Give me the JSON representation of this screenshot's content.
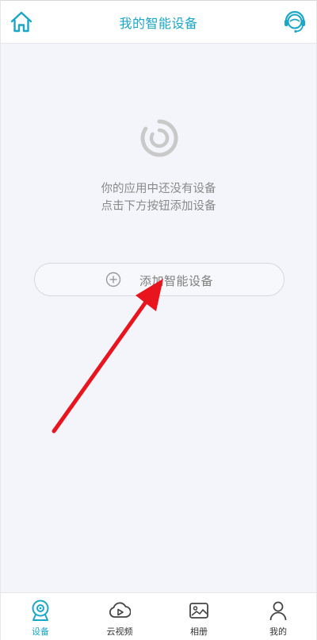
{
  "header": {
    "title": "我的智能设备",
    "home_icon": "home-icon",
    "support_icon": "customer-service-icon"
  },
  "empty_state": {
    "icon": "loading-ring-icon",
    "line1": "你的应用中还没有设备",
    "line2": "点击下方按钮添加设备"
  },
  "add_button": {
    "icon": "plus-circle-icon",
    "label": "添加智能设备"
  },
  "tabbar": {
    "active_index": 0,
    "items": [
      {
        "label": "设备",
        "icon": "camera-icon"
      },
      {
        "label": "云视频",
        "icon": "cloud-video-icon"
      },
      {
        "label": "相册",
        "icon": "album-icon"
      },
      {
        "label": "我的",
        "icon": "person-icon"
      }
    ]
  },
  "colors": {
    "accent": "#1aa6c9",
    "background": "#f4f5fa",
    "annotation_arrow": "#e8141e"
  }
}
